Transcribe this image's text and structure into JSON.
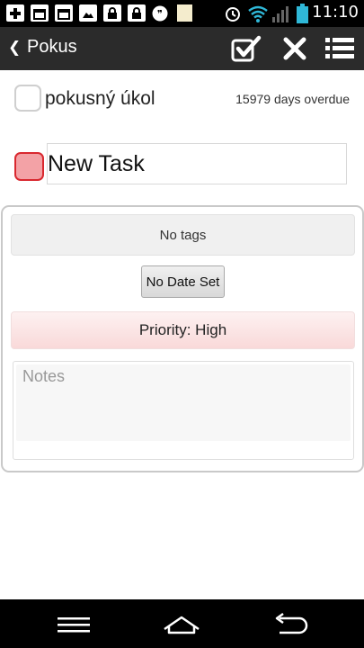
{
  "status_bar": {
    "time": "11:10",
    "icons": [
      "add-icon",
      "calendar-icon",
      "calendar-icon",
      "image-icon",
      "lock-icon",
      "lock-icon",
      "quote-icon",
      "note-icon",
      "alarm-icon",
      "wifi-icon",
      "signal-icon",
      "battery-icon"
    ]
  },
  "action_bar": {
    "back_icon": "chevron-left-icon",
    "title": "Pokus",
    "actions": [
      "check-save-icon",
      "close-icon",
      "list-icon"
    ]
  },
  "tasks": [
    {
      "title": "pokusný úkol",
      "status": "15979 days overdue",
      "checked": false
    }
  ],
  "new_task": {
    "value": "New Task",
    "placeholder": "",
    "checkbox_color": "#f3a2a6"
  },
  "details": {
    "tags": "No tags",
    "date_button": "No Date Set",
    "priority": "Priority: High",
    "notes_placeholder": "Notes"
  },
  "nav_bar": {
    "buttons": [
      "menu-icon",
      "home-icon",
      "back-icon"
    ]
  },
  "colors": {
    "action_bar": "#2b2b2b",
    "priority_high": "#f9d9d9",
    "new_task_border": "#d9282f"
  }
}
